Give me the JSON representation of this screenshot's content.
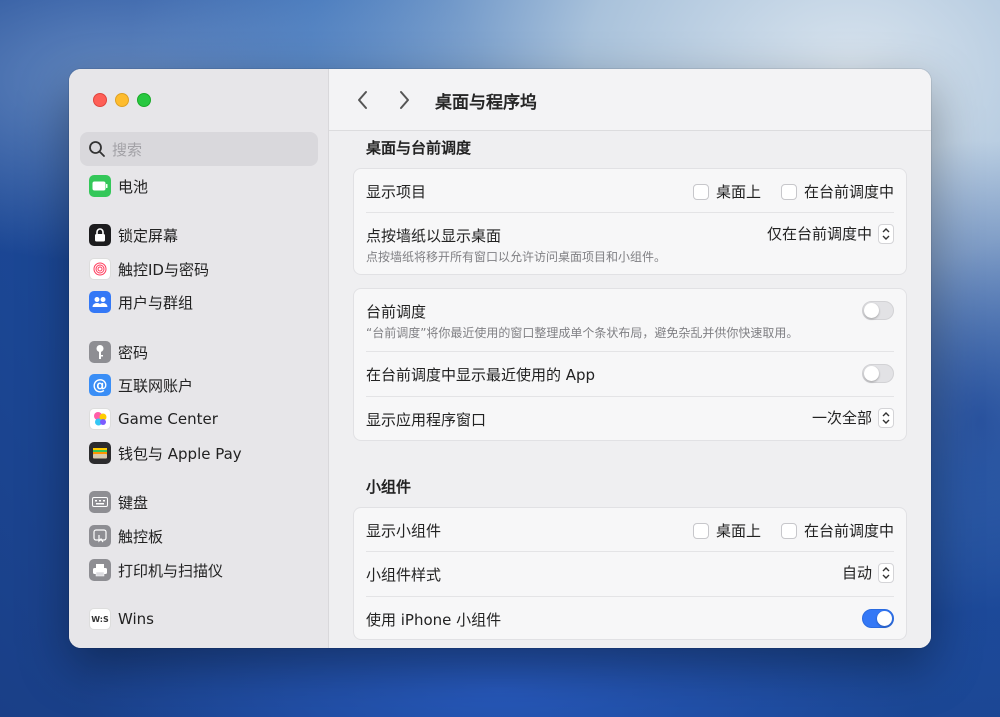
{
  "window": {
    "toolbar_title": "桌面与程序坞"
  },
  "sidebar": {
    "search_placeholder": "搜索",
    "items": [
      {
        "label": "电池",
        "icon": "battery-icon",
        "color": "#34c759"
      },
      {
        "label": "锁定屏幕",
        "icon": "lock-icon",
        "color": "#1c1c1e"
      },
      {
        "label": "触控ID与密码",
        "icon": "fingerprint-icon",
        "color": "#ffffff"
      },
      {
        "label": "用户与群组",
        "icon": "users-icon",
        "color": "#3478f6"
      },
      {
        "label": "密码",
        "icon": "key-icon",
        "color": "#8e8e93"
      },
      {
        "label": "互联网账户",
        "icon": "at-icon",
        "color": "#3a8ef6"
      },
      {
        "label": "Game Center",
        "icon": "game-center-icon",
        "color": "#ffffff"
      },
      {
        "label": "钱包与 Apple Pay",
        "icon": "wallet-icon",
        "color": "#2c2c2e"
      },
      {
        "label": "键盘",
        "icon": "keyboard-icon",
        "color": "#8e8e93"
      },
      {
        "label": "触控板",
        "icon": "trackpad-icon",
        "color": "#8e8e93"
      },
      {
        "label": "打印机与扫描仪",
        "icon": "printer-icon",
        "color": "#8e8e93"
      },
      {
        "label": "Wins",
        "icon": "wins-icon",
        "color": "#ffffff"
      }
    ]
  },
  "stage_section": {
    "title": "桌面与台前调度",
    "show_items": {
      "label": "显示项目",
      "opt_desktop": "桌面上",
      "opt_stage": "在台前调度中"
    },
    "click_wallpaper": {
      "label": "点按墙纸以显示桌面",
      "sub": "点按墙纸将移开所有窗口以允许访问桌面项目和小组件。",
      "value": "仅在台前调度中"
    },
    "stage_manager": {
      "label": "台前调度",
      "sub": "“台前调度”将你最近使用的窗口整理成单个条状布局，避免杂乱并供你快速取用。",
      "on": false
    },
    "recent_apps": {
      "label": "在台前调度中显示最近使用的 App",
      "on": false
    },
    "app_windows": {
      "label": "显示应用程序窗口",
      "value": "一次全部"
    }
  },
  "widgets_section": {
    "title": "小组件",
    "show_widgets": {
      "label": "显示小组件",
      "opt_desktop": "桌面上",
      "opt_stage": "在台前调度中"
    },
    "widget_style": {
      "label": "小组件样式",
      "value": "自动"
    },
    "iphone_widgets": {
      "label": "使用 iPhone 小组件",
      "on": true
    }
  },
  "colors": {
    "accent": "#3478f6",
    "close": "#fe5f57",
    "minimize": "#febc2e",
    "zoom": "#28c840"
  }
}
